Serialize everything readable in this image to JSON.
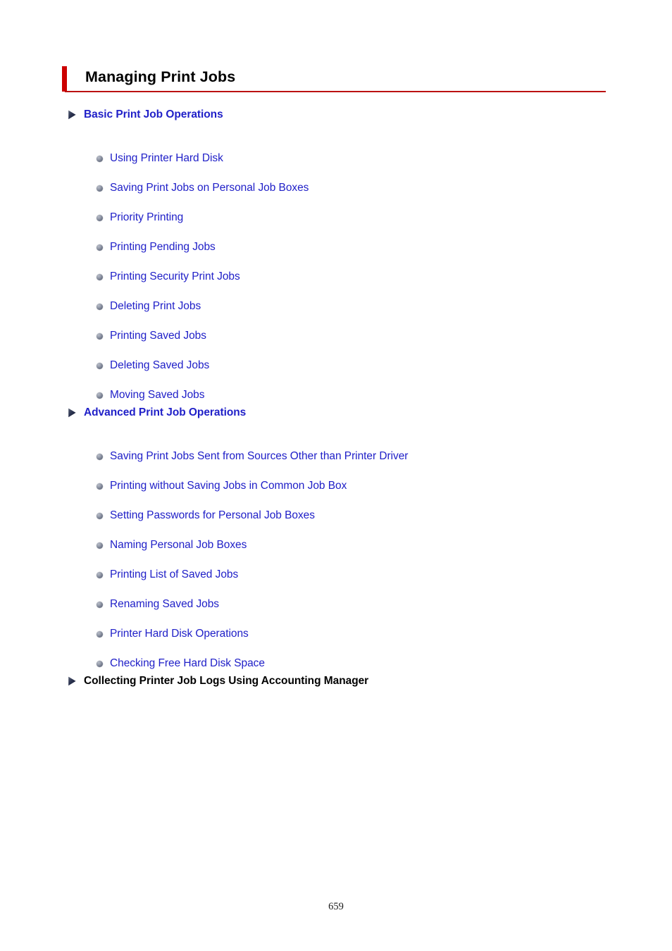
{
  "document": {
    "title": "Managing Print Jobs",
    "page_number": "659",
    "accent_color": "#cc0000",
    "rule_color": "#bb1111",
    "link_color": "#2020c8",
    "text_color": "#000000",
    "background_color": "#ffffff"
  },
  "sections": [
    {
      "id": "basic-print-job-operations",
      "label": "Basic Print Job Operations",
      "is_link": true,
      "marker": "arrow-right-icon",
      "items": [
        {
          "label": "Using Printer Hard Disk",
          "marker": "bullet-icon"
        },
        {
          "label": "Saving Print Jobs on Personal Job Boxes",
          "marker": "bullet-icon"
        },
        {
          "label": "Priority Printing",
          "marker": "bullet-icon"
        },
        {
          "label": "Printing Pending Jobs",
          "marker": "bullet-icon"
        },
        {
          "label": "Printing Security Print Jobs",
          "marker": "bullet-icon"
        },
        {
          "label": "Deleting Print Jobs",
          "marker": "bullet-icon"
        },
        {
          "label": "Printing Saved Jobs",
          "marker": "bullet-icon"
        },
        {
          "label": "Deleting Saved Jobs",
          "marker": "bullet-icon"
        },
        {
          "label": "Moving Saved Jobs",
          "marker": "bullet-icon"
        }
      ]
    },
    {
      "id": "advanced-print-job-operations",
      "label": "Advanced Print Job Operations",
      "is_link": true,
      "marker": "arrow-right-icon",
      "items": [
        {
          "label": "Saving Print Jobs Sent from Sources Other than Printer Driver",
          "marker": "bullet-icon"
        },
        {
          "label": "Printing without Saving Jobs in Common Job Box",
          "marker": "bullet-icon"
        },
        {
          "label": "Setting Passwords for Personal Job Boxes",
          "marker": "bullet-icon"
        },
        {
          "label": "Naming Personal Job Boxes",
          "marker": "bullet-icon"
        },
        {
          "label": "Printing List of Saved Jobs",
          "marker": "bullet-icon"
        },
        {
          "label": "Renaming Saved Jobs",
          "marker": "bullet-icon"
        },
        {
          "label": "Printer Hard Disk Operations",
          "marker": "bullet-icon"
        },
        {
          "label": "Checking Free Hard Disk Space",
          "marker": "bullet-icon"
        }
      ]
    },
    {
      "id": "collecting-printer-job-logs",
      "label": "Collecting Printer Job Logs Using Accounting Manager",
      "is_link": false,
      "marker": "arrow-right-icon",
      "items": []
    }
  ],
  "layout": {
    "section_tops": [
      153,
      576,
      957
    ],
    "item_start_offsets": [
      42,
      42,
      0
    ],
    "item_spacing": 42
  }
}
